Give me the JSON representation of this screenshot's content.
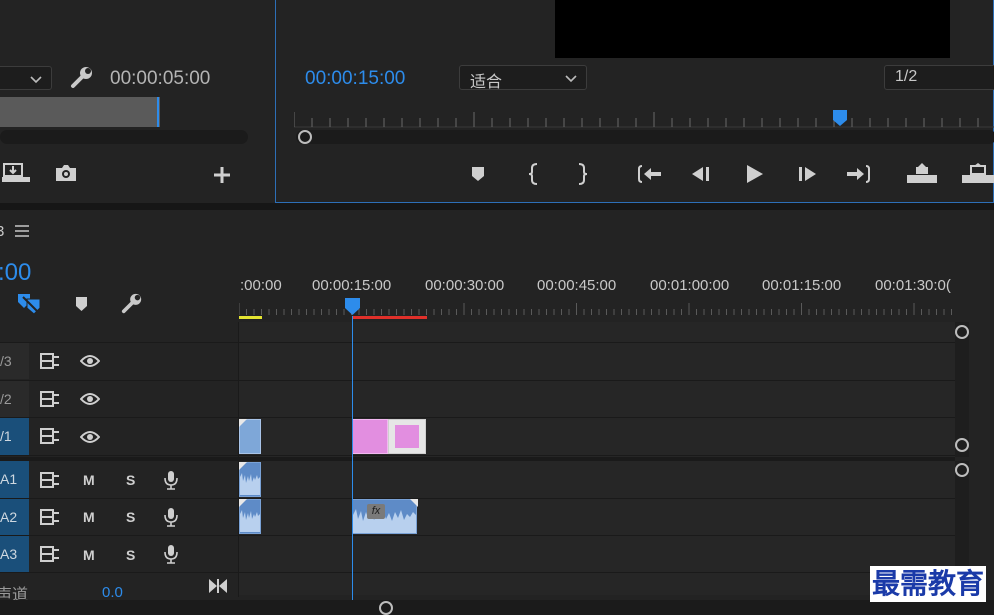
{
  "source_monitor": {
    "timecode": "00:00:05:00"
  },
  "program_monitor": {
    "timecode": "00:00:15:00",
    "fit_dropdown": "适合",
    "resolution_dropdown": "1/2"
  },
  "timeline": {
    "panel_tab_partial": "3",
    "timecode_partial": ":00",
    "ruler_labels": [
      ":00:00",
      "00:00:15:00",
      "00:00:30:00",
      "00:00:45:00",
      "00:01:00:00",
      "00:01:15:00",
      "00:01:30:0("
    ],
    "tracks": {
      "V3": "/3",
      "V2": "/2",
      "V1": "/1",
      "A1": "A1",
      "A2": "A2",
      "A3": "A3"
    },
    "mute_label": "M",
    "solo_label": "S",
    "master_label": "声道",
    "master_value": "0.0",
    "fx_label": "fx"
  },
  "watermark": "最需教育",
  "colors": {
    "accent": "#2d8ceb",
    "video_clip": "#7ea7d8",
    "pink_clip": "#e28ee0",
    "audio_clip": "#5e8bc7",
    "in_out_bar": "#e0302a",
    "work_area": "#e5e532"
  }
}
